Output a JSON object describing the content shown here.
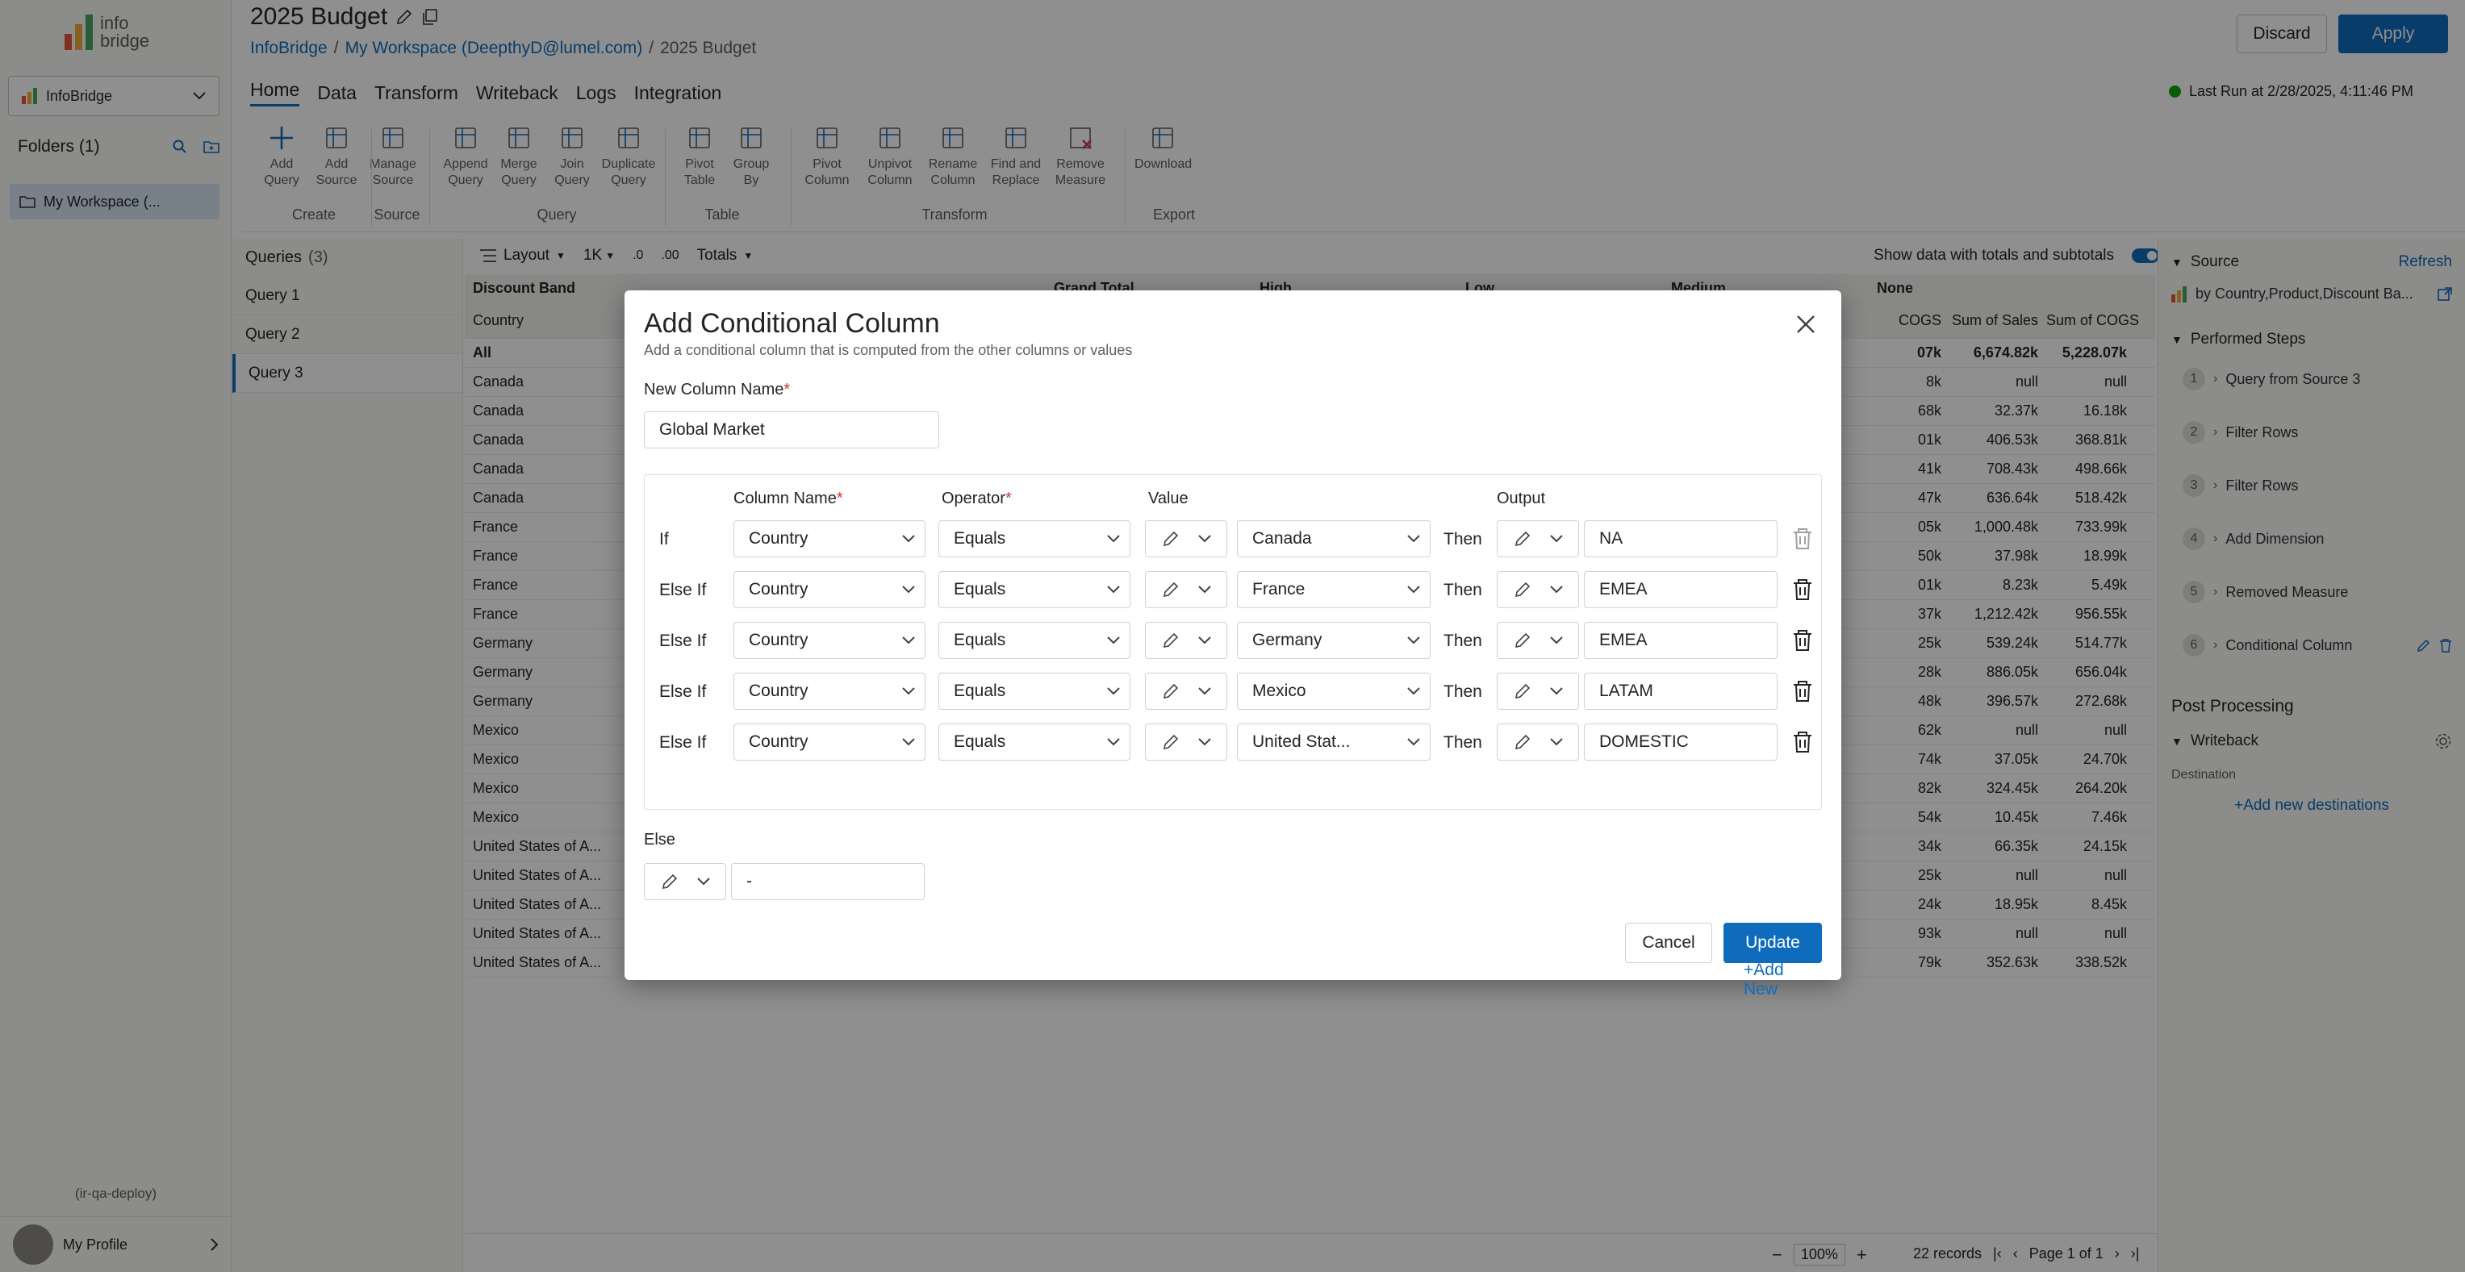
{
  "app": {
    "logo_text": "info bridge",
    "app_select": "InfoBridge",
    "folders_label": "Folders (1)",
    "workspace_item": "My Workspace (...",
    "env_label": "(ir-qa-deploy)",
    "profile_label": "My Profile"
  },
  "header": {
    "title": "2025 Budget",
    "breadcrumb": [
      "InfoBridge",
      "/",
      "My Workspace (DeepthyD@lumel.com)",
      "/",
      "2025 Budget"
    ],
    "discard": "Discard",
    "apply": "Apply",
    "last_run": "Last Run at 2/28/2025, 4:11:46 PM"
  },
  "menu_tabs": [
    "Home",
    "Data",
    "Transform",
    "Writeback",
    "Logs",
    "Integration"
  ],
  "ribbon": {
    "buttons": [
      {
        "label1": "Add",
        "label2": "Query",
        "icon": "plus-icon"
      },
      {
        "label1": "Add",
        "label2": "Source",
        "icon": "add-source-icon"
      },
      {
        "label1": "Manage",
        "label2": "Source",
        "icon": "manage-source-icon"
      },
      {
        "label1": "Append",
        "label2": "Query",
        "icon": "append-query-icon"
      },
      {
        "label1": "Merge",
        "label2": "Query",
        "icon": "merge-query-icon"
      },
      {
        "label1": "Join",
        "label2": "Query",
        "icon": "join-query-icon"
      },
      {
        "label1": "Duplicate",
        "label2": "Query",
        "icon": "duplicate-query-icon"
      },
      {
        "label1": "Pivot",
        "label2": "Table",
        "icon": "pivot-table-icon"
      },
      {
        "label1": "Group",
        "label2": "By",
        "icon": "group-by-icon"
      },
      {
        "label1": "Pivot",
        "label2": "Column",
        "icon": "pivot-column-icon"
      },
      {
        "label1": "Unpivot",
        "label2": "Column",
        "icon": "unpivot-column-icon"
      },
      {
        "label1": "Rename",
        "label2": "Column",
        "icon": "rename-column-icon"
      },
      {
        "label1": "Find and",
        "label2": "Replace",
        "icon": "find-replace-icon"
      },
      {
        "label1": "Remove",
        "label2": "Measure",
        "icon": "remove-measure-icon"
      },
      {
        "label1": "Download",
        "label2": "",
        "icon": "download-icon"
      }
    ],
    "groups": [
      "Create",
      "Source",
      "Query",
      "Table",
      "Transform",
      "Export"
    ]
  },
  "queries": {
    "header": "Queries",
    "count": "(3)",
    "items": [
      "Query 1",
      "Query 2",
      "Query 3"
    ]
  },
  "grid_toolbar": {
    "layout": "Layout",
    "scale": "1K",
    "decimal_inc": ".0",
    "decimal_dec": ".00",
    "totals": "Totals",
    "show_totals": "Show data with totals and subtotals"
  },
  "grid": {
    "band_header": "Discount Band",
    "grand_total": "Grand Total",
    "high": "High",
    "low": "Low",
    "medium": "Medium",
    "none": "None",
    "country_header": "Country",
    "sum_cogs_header": "COGS",
    "sum_sales_header": "Sum of Sales",
    "sum_cogs_header2": "Sum of COGS",
    "rows": [
      {
        "country": "All",
        "p": "07k",
        "sales": "6,674.82k",
        "cogs": "5,228.07k"
      },
      {
        "country": "Canada",
        "p": "8k",
        "sales": "null",
        "cogs": "null"
      },
      {
        "country": "Canada",
        "p": "68k",
        "sales": "32.37k",
        "cogs": "16.18k"
      },
      {
        "country": "Canada",
        "p": "01k",
        "sales": "406.53k",
        "cogs": "368.81k"
      },
      {
        "country": "Canada",
        "p": "41k",
        "sales": "708.43k",
        "cogs": "498.66k"
      },
      {
        "country": "Canada",
        "p": "47k",
        "sales": "636.64k",
        "cogs": "518.42k"
      },
      {
        "country": "France",
        "p": "05k",
        "sales": "1,000.48k",
        "cogs": "733.99k"
      },
      {
        "country": "France",
        "p": "50k",
        "sales": "37.98k",
        "cogs": "18.99k"
      },
      {
        "country": "France",
        "p": "01k",
        "sales": "8.23k",
        "cogs": "5.49k"
      },
      {
        "country": "France",
        "p": "37k",
        "sales": "1,212.42k",
        "cogs": "956.55k"
      },
      {
        "country": "Germany",
        "p": "25k",
        "sales": "539.24k",
        "cogs": "514.77k"
      },
      {
        "country": "Germany",
        "p": "28k",
        "sales": "886.05k",
        "cogs": "656.04k"
      },
      {
        "country": "Germany",
        "p": "48k",
        "sales": "396.57k",
        "cogs": "272.68k"
      },
      {
        "country": "Mexico",
        "p": "62k",
        "sales": "null",
        "cogs": "null"
      },
      {
        "country": "Mexico",
        "p": "74k",
        "sales": "37.05k",
        "cogs": "24.70k"
      },
      {
        "country": "Mexico",
        "p": "82k",
        "sales": "324.45k",
        "cogs": "264.20k"
      },
      {
        "country": "Mexico",
        "p": "54k",
        "sales": "10.45k",
        "cogs": "7.46k"
      },
      {
        "country": "United States of A...",
        "p": "34k",
        "sales": "66.35k",
        "cogs": "24.15k"
      },
      {
        "country": "United States of A...",
        "p": "25k",
        "sales": "null",
        "cogs": "null"
      },
      {
        "country": "United States of A...",
        "p": "24k",
        "sales": "18.95k",
        "cogs": "8.45k"
      },
      {
        "country": "United States of A...",
        "p": "93k",
        "sales": "null",
        "cogs": "null"
      },
      {
        "country": "United States of A...",
        "p": "79k",
        "sales": "352.63k",
        "cogs": "338.52k"
      }
    ]
  },
  "status_bar": {
    "zoom": "100%",
    "records": "22 records",
    "page": "Page 1 of 1"
  },
  "right_panel": {
    "source_label": "Source",
    "refresh": "Refresh",
    "source_name": "by Country,Product,Discount Ba...",
    "performed_steps": "Performed Steps",
    "steps": [
      {
        "num": "1",
        "label": "Query from Source 3"
      },
      {
        "num": "2",
        "label": "Filter Rows"
      },
      {
        "num": "3",
        "label": "Filter Rows"
      },
      {
        "num": "4",
        "label": "Add Dimension"
      },
      {
        "num": "5",
        "label": "Removed Measure"
      },
      {
        "num": "6",
        "label": "Conditional Column"
      }
    ],
    "post_processing": "Post Processing",
    "writeback": "Writeback",
    "destination": "Destination",
    "add_destination": "+Add new destinations"
  },
  "dialog": {
    "title": "Add Conditional Column",
    "subtitle": "Add a conditional column that is computed from the other columns or values",
    "new_column_label": "New Column Name",
    "new_column_value": "Global Market",
    "col_name_header": "Column Name",
    "operator_header": "Operator",
    "value_header": "Value",
    "output_header": "Output",
    "required_mark": "*",
    "then_label": "Then",
    "conditions": [
      {
        "kw": "If",
        "column": "Country",
        "operator": "Equals",
        "value": "Canada",
        "output": "NA"
      },
      {
        "kw": "Else If",
        "column": "Country",
        "operator": "Equals",
        "value": "France",
        "output": "EMEA"
      },
      {
        "kw": "Else If",
        "column": "Country",
        "operator": "Equals",
        "value": "Germany",
        "output": "EMEA"
      },
      {
        "kw": "Else If",
        "column": "Country",
        "operator": "Equals",
        "value": "Mexico",
        "output": "LATAM"
      },
      {
        "kw": "Else If",
        "column": "Country",
        "operator": "Equals",
        "value": "United Stat...",
        "output": "DOMESTIC"
      }
    ],
    "add_new": "+Add New",
    "else_label": "Else",
    "else_value": "-",
    "cancel": "Cancel",
    "update": "Update"
  },
  "colors": {
    "accent": "#0f6cbd",
    "success": "#13a10e"
  }
}
